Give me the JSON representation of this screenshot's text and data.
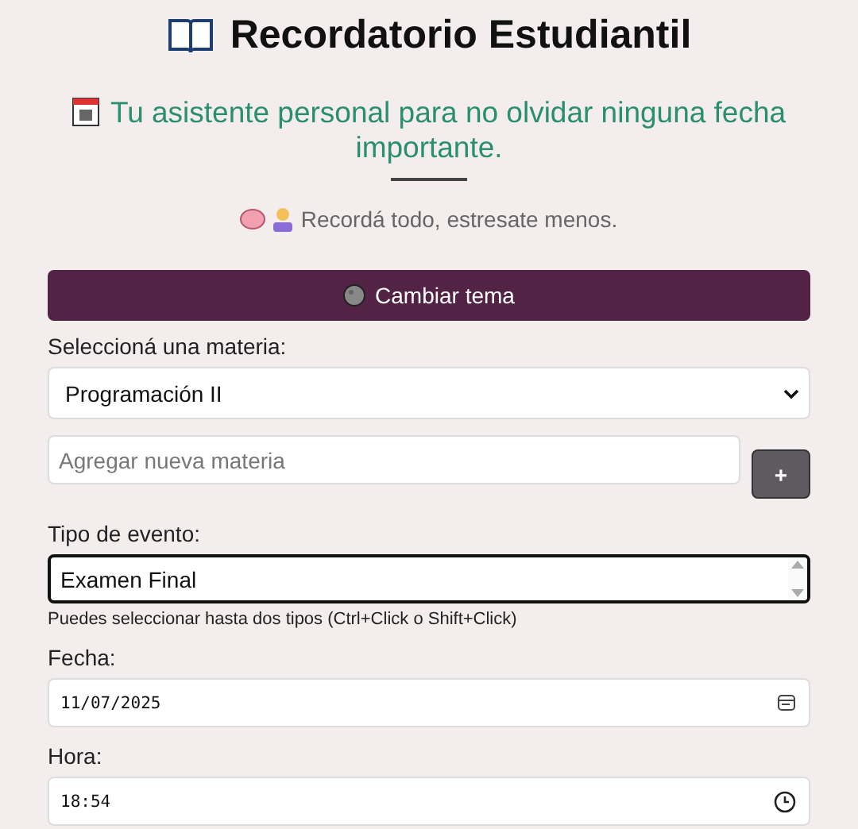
{
  "header": {
    "title": "Recordatorio Estudiantil",
    "subtitle": "Tu asistente personal para no olvidar ninguna fecha importante.",
    "tagline": "Recordá todo, estresate menos."
  },
  "theme_button": {
    "label": "Cambiar tema"
  },
  "subject": {
    "label": "Seleccioná una materia:",
    "value": "Programación II"
  },
  "new_subject": {
    "placeholder": "Agregar nueva materia",
    "button": "+"
  },
  "event_type": {
    "label": "Tipo de evento:",
    "options": [
      {
        "label": "Examen Final",
        "selected": false
      }
    ],
    "hint": "Puedes seleccionar hasta dos tipos (Ctrl+Click o Shift+Click)"
  },
  "date": {
    "label": "Fecha:",
    "value": "11/07/2025"
  },
  "time": {
    "label": "Hora:",
    "value": "18:54"
  }
}
